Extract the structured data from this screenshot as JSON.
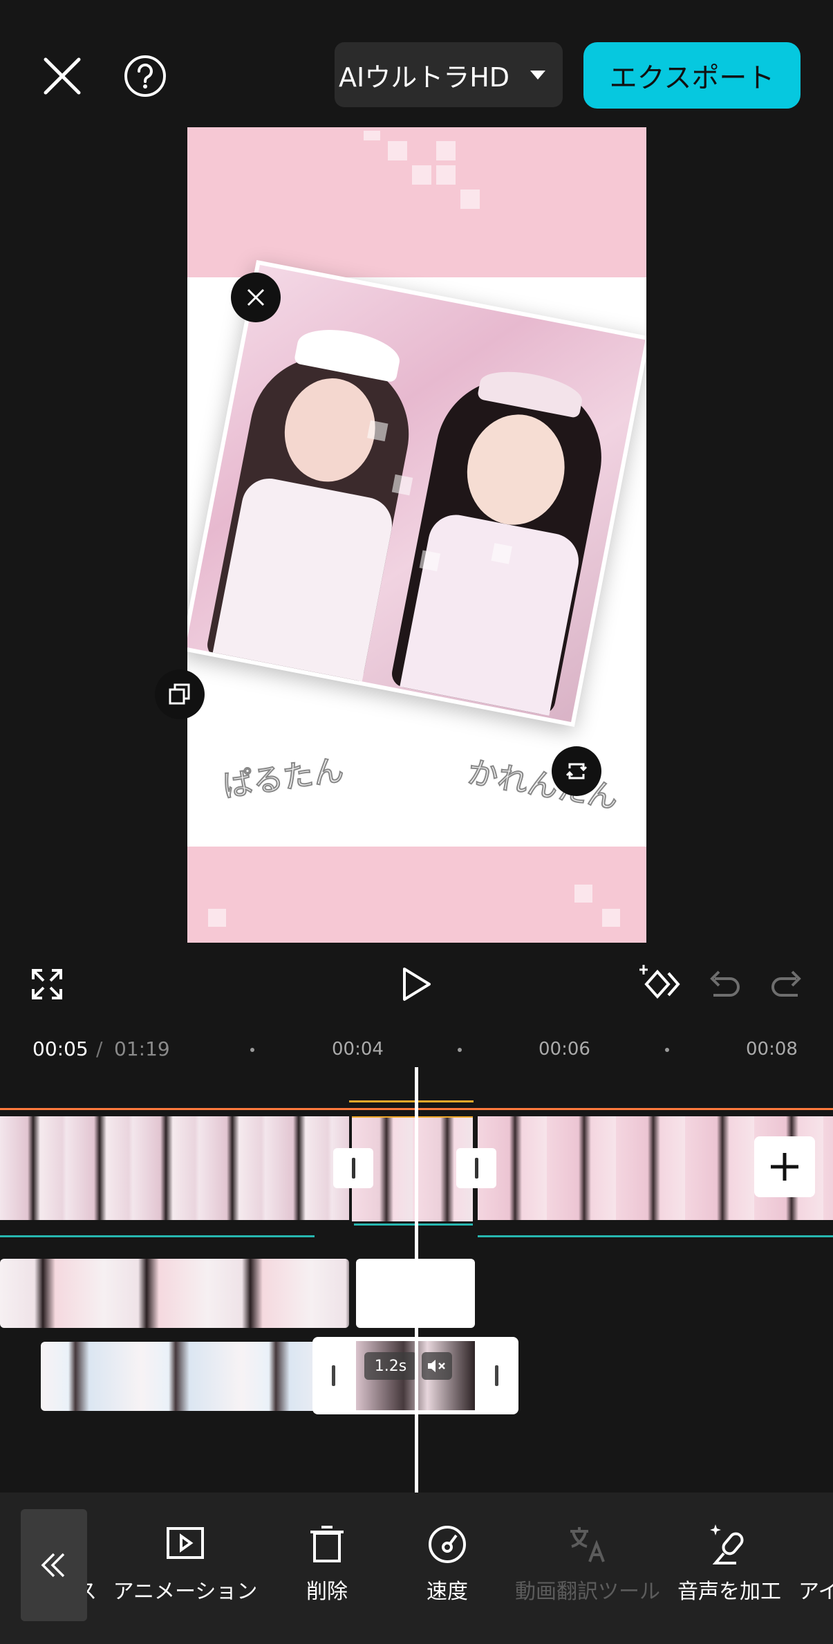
{
  "header": {
    "quality_label": "AIウルトラHD",
    "export_label": "エクスポート"
  },
  "preview": {
    "signature_left": "ぱるたん",
    "signature_right": "かれんたん"
  },
  "playback": {
    "current_time": "00:05",
    "separator": "/",
    "total_time": "01:19",
    "ruler": [
      "00:04",
      "00:06",
      "00:08"
    ]
  },
  "timeline": {
    "overlay_clip_duration": "1.2s"
  },
  "toolbar": {
    "cut_item_partial": "ス",
    "items": [
      "アニメーション",
      "削除",
      "速度",
      "動画翻訳ツール",
      "音声を加工",
      "アイ"
    ]
  },
  "colors": {
    "accent": "#06c8df",
    "playhead": "#ffffff",
    "track_orange": "#ff7a3d",
    "track_teal": "#27b7b0",
    "selection_gold": "#f0a92a"
  },
  "icons": [
    "close-icon",
    "help-icon",
    "fullscreen-icon",
    "play-icon",
    "keyframe-add-icon",
    "undo-icon",
    "redo-icon",
    "add-clip-icon",
    "mute-icon",
    "collapse-icon",
    "animation-icon",
    "delete-icon",
    "speed-icon",
    "translate-icon",
    "voice-effect-icon"
  ]
}
